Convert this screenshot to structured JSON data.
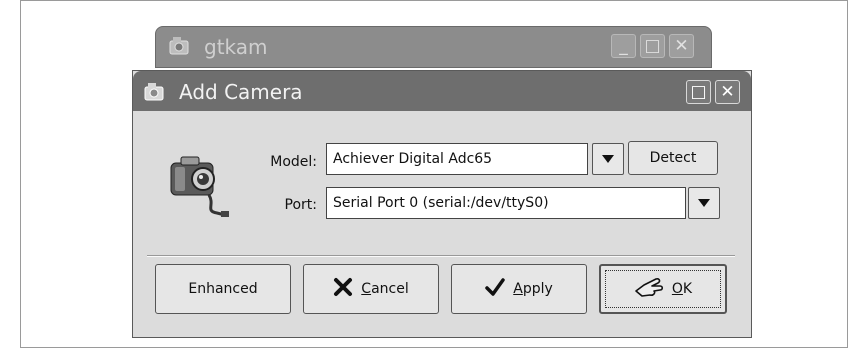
{
  "background_window": {
    "title": "gtkam",
    "controls": [
      "minimize",
      "maximize",
      "close"
    ]
  },
  "dialog": {
    "title": "Add Camera",
    "controls": [
      "maximize",
      "close"
    ],
    "model": {
      "label": "Model:",
      "value": "Achiever Digital Adc65"
    },
    "port": {
      "label": "Port:",
      "value": "Serial Port 0 (serial:/dev/ttyS0)"
    },
    "detect_label": "Detect",
    "buttons": {
      "enhanced": "Enhanced",
      "cancel_mnemonic": "C",
      "cancel_rest": "ancel",
      "apply_mnemonic": "A",
      "apply_rest": "pply",
      "ok_mnemonic": "O",
      "ok_rest": "K"
    }
  },
  "icons": {
    "app": "camera-small-icon",
    "camera": "digital-camera-icon",
    "cancel": "x-cross-icon",
    "apply": "checkmark-icon",
    "ok": "hand-pointing-icon"
  }
}
